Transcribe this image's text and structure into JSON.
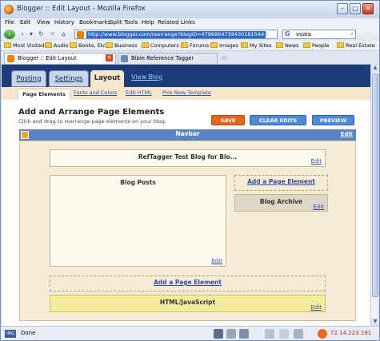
{
  "window": {
    "title": "Blogger :: Edit Layout - Mozilla Firefox"
  },
  "menu": [
    "File",
    "Edit",
    "View",
    "History",
    "Bookmarks",
    "Split",
    "Tools",
    "Help",
    "Related Links"
  ],
  "address": {
    "url": "http://www.blogger.com/rearrange?blogID=4796804739430181544",
    "search_engine": "G",
    "search_query": "voala"
  },
  "bookmarks": [
    "Most Visited",
    "Audio",
    "Books, Etc.",
    "Business",
    "Computers",
    "Forums",
    "Images",
    "My Sites",
    "News",
    "People",
    "Real Estate"
  ],
  "browser_tabs": [
    {
      "label": "Blogger :: Edit Layout",
      "active": true
    },
    {
      "label": "Bible Reference Tagger",
      "active": false
    }
  ],
  "blogger": {
    "tabs": [
      "Posting",
      "Settings",
      "Layout"
    ],
    "active_tab": "Layout",
    "view_blog": "View Blog",
    "subtabs": [
      "Page Elements",
      "Fonts and Colors",
      "Edit HTML",
      "Pick New Template"
    ],
    "heading": "Add and Arrange Page Elements",
    "subheading": "Click and drag to rearrange page elements on your blog.",
    "buttons": {
      "save": "SAVE",
      "clear": "CLEAR EDITS",
      "preview": "PREVIEW"
    },
    "navbar": {
      "title": "Navbar",
      "edit": "Edit"
    },
    "header_gadget": {
      "title": "RefTagger Test Blog for Blo...",
      "edit": "Edit"
    },
    "posts_gadget": {
      "title": "Blog Posts",
      "edit": "Edit"
    },
    "sidebar_add": "Add a Page Element",
    "archive_gadget": {
      "title": "Blog Archive",
      "edit": "Edit"
    },
    "footer_add": "Add a Page Element",
    "footer_gadget": {
      "title": "HTML/JavaScript",
      "edit": "Edit"
    }
  },
  "status": {
    "text": "Done",
    "ip": "72.14.223.191"
  }
}
